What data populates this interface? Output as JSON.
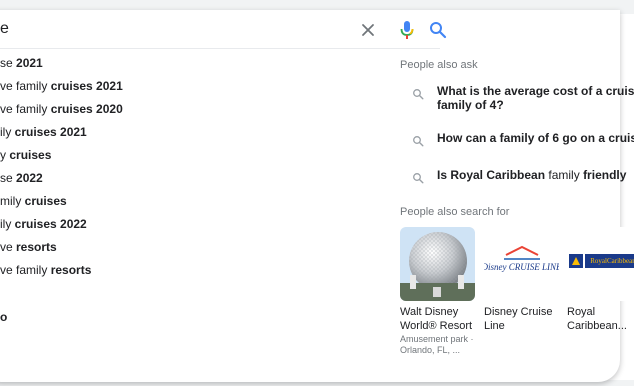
{
  "search": {
    "query": "e",
    "icons": {
      "clear": "close-icon",
      "voice": "mic-icon",
      "search": "search-icon"
    }
  },
  "suggestions": [
    {
      "plain": "se ",
      "bold": "2021"
    },
    {
      "plain": "ve family ",
      "bold": "cruises 2021"
    },
    {
      "plain": "ve family ",
      "bold": "cruises 2020"
    },
    {
      "plain": "ily ",
      "bold": "cruises 2021"
    },
    {
      "plain": "y ",
      "bold": "cruises"
    },
    {
      "plain": "se ",
      "bold": "2022"
    },
    {
      "plain": "mily ",
      "bold": "cruises"
    },
    {
      "plain": "ily ",
      "bold": "cruises 2022"
    },
    {
      "plain": "ve ",
      "bold": "resorts"
    },
    {
      "plain": "ve family ",
      "bold": "resorts"
    },
    {
      "plain": "",
      "bold": "o"
    }
  ],
  "people_also_ask": {
    "label": "People also ask",
    "items": [
      {
        "bold_a": "What is the average cost of a cruis",
        "normal": "",
        "bold_b": "",
        "line2": "family of 4?"
      },
      {
        "bold_a": "How can a family of 6 go on a cruis",
        "normal": "",
        "bold_b": "",
        "line2": ""
      },
      {
        "bold_a": "Is Royal Caribbean",
        "normal": " family ",
        "bold_b": "friendly",
        "line2": ""
      }
    ]
  },
  "people_also_search_for": {
    "label": "People also search for",
    "cards": [
      {
        "title": "Walt Disney World® Resort",
        "subtitle": "Amusement park · Orlando, FL, ...",
        "image": "epcot-sphere-photo"
      },
      {
        "title": "Disney Cruise Line",
        "subtitle": "",
        "image": "disney-cruise-line-logo",
        "logo_text": "Disney CRUISE LINE"
      },
      {
        "title": "Royal Caribbean...",
        "subtitle": "",
        "image": "royal-caribbean-logo",
        "logo_text": "RoyalCaribbean INTERNATIONAL"
      }
    ]
  },
  "colors": {
    "text": "#202124",
    "secondary": "#70757a",
    "google_blue": "#4285f4",
    "google_red": "#ea4335",
    "google_yellow": "#fbbc04",
    "google_green": "#34a853",
    "royal_navy": "#1a3a8a"
  }
}
